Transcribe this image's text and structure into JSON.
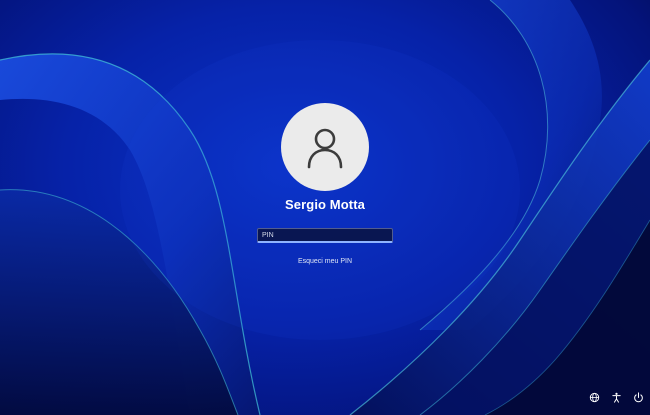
{
  "user": {
    "name": "Sergio Motta",
    "avatar_icon": "user-silhouette-icon"
  },
  "pin": {
    "placeholder": "PIN",
    "value": ""
  },
  "links": {
    "forgot_pin": "Esqueci meu PIN"
  },
  "tray": {
    "network_icon": "network-icon",
    "accessibility_icon": "accessibility-icon",
    "power_icon": "power-icon"
  },
  "colors": {
    "accent": "#8fb4ff",
    "background": "#0622a8"
  }
}
